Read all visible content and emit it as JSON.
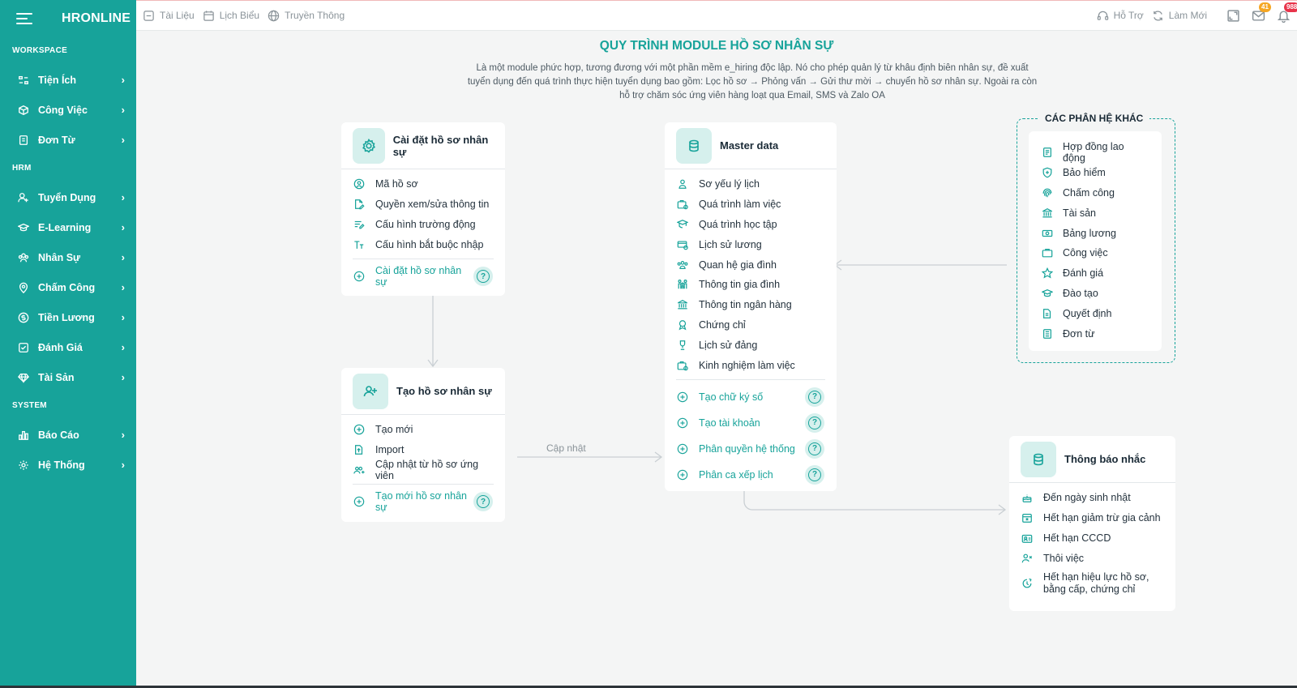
{
  "sidebar": {
    "logo": "HRONLINE",
    "sections": [
      {
        "title": "WORKSPACE",
        "items": [
          {
            "label": "Tiện Ích",
            "icon": "widgets-icon"
          },
          {
            "label": "Công Việc",
            "icon": "box-icon"
          },
          {
            "label": "Đơn Từ",
            "icon": "document-icon"
          }
        ]
      },
      {
        "title": "HRM",
        "items": [
          {
            "label": "Tuyển Dụng",
            "icon": "user-plus-icon"
          },
          {
            "label": "E-Learning",
            "icon": "graduation-cap-icon"
          },
          {
            "label": "Nhân Sự",
            "icon": "users-icon"
          },
          {
            "label": "Chấm Công",
            "icon": "location-icon"
          },
          {
            "label": "Tiền Lương",
            "icon": "dollar-icon"
          },
          {
            "label": "Đánh Giá",
            "icon": "check-square-icon"
          },
          {
            "label": "Tài Sản",
            "icon": "diamond-icon"
          }
        ]
      },
      {
        "title": "SYSTEM",
        "items": [
          {
            "label": "Báo Cáo",
            "icon": "bar-chart-icon"
          },
          {
            "label": "Hệ Thống",
            "icon": "gear-icon"
          }
        ]
      }
    ]
  },
  "topbar": {
    "links": [
      "Tài Liệu",
      "Lịch Biểu",
      "Truyền Thông"
    ],
    "support": "Hỗ Trợ",
    "refresh": "Làm Mới",
    "mail_badge": "41",
    "bell_badge": "988"
  },
  "main": {
    "title": "QUY TRÌNH MODULE HỒ SƠ NHÂN SỰ",
    "description": "Là một module phức hợp, tương đương với một phần mềm e_hiring độc lập. Nó cho phép quản lý từ khâu định biên nhân sự, đề xuất tuyển dụng đến quá trình thực hiện tuyển dụng bao gồm: Lọc hồ sơ → Phỏng vấn → Gửi thư mời → chuyển hồ sơ nhân sự. Ngoài ra còn hỗ trợ chăm sóc ứng viên hàng loạt qua Email, SMS và Zalo OA",
    "connector_label": "Cập nhật"
  },
  "card_settings": {
    "title": "Cài đặt hồ sơ nhân sự",
    "items": [
      "Mã hồ sơ",
      "Quyền xem/sửa thông tin",
      "Cấu hình trường động",
      "Cấu hình bắt buộc nhập"
    ],
    "action": "Cài đặt hồ sơ nhân sự"
  },
  "card_create": {
    "title": "Tạo hồ sơ nhân sự",
    "items": [
      "Tạo mới",
      "Import",
      "Cập nhật từ hồ sơ ứng viên"
    ],
    "action": "Tạo mới hồ sơ nhân sự"
  },
  "card_master": {
    "title": "Master data",
    "items": [
      "Sơ yếu lý lịch",
      "Quá trình làm việc",
      "Quá trình học tập",
      "Lịch sử lương",
      "Quan hệ gia đình",
      "Thông tin gia đình",
      "Thông tin ngân hàng",
      "Chứng chỉ",
      "Lịch sử đảng",
      "Kinh nghiệm làm việc"
    ],
    "actions": [
      "Tạo chữ ký số",
      "Tạo tài khoản",
      "Phân quyền hệ thống",
      "Phân ca xếp lịch"
    ]
  },
  "card_other": {
    "title": "CÁC PHÂN HỆ KHÁC",
    "items": [
      "Hợp đồng lao động",
      "Bảo hiểm",
      "Chấm công",
      "Tài sản",
      "Bảng lương",
      "Công việc",
      "Đánh giá",
      "Đào tạo",
      "Quyết định",
      "Đơn từ"
    ]
  },
  "card_notify": {
    "title": "Thông báo nhắc",
    "items": [
      "Đến ngày sinh nhật",
      "Hết hạn giảm trừ gia cảnh",
      "Hết hạn CCCD",
      "Thôi việc"
    ],
    "item_multi_line1": "Hết hạn hiệu lực hồ sơ,",
    "item_multi_line2": "bằng cấp, chứng chỉ"
  },
  "colors": {
    "accent": "#17a39a",
    "background": "#f4f5f5"
  }
}
